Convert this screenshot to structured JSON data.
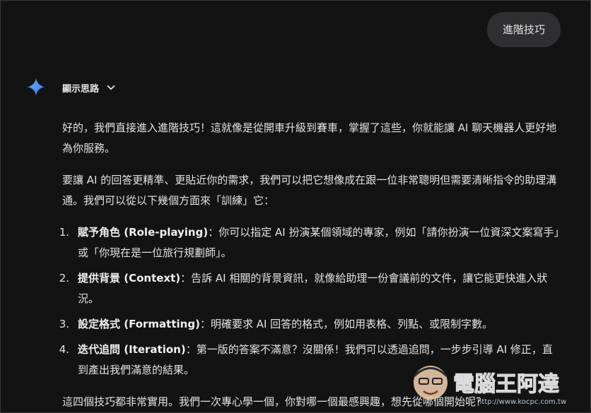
{
  "user_message": "進階技巧",
  "thinking": {
    "label": "顯示思路"
  },
  "response": {
    "intro": "好的，我們直接進入進階技巧！這就像是從開車升級到賽車，掌握了這些，你就能讓 AI 聊天機器人更好地為你服務。",
    "lead": "要讓 AI 的回答更精準、更貼近你的需求，我們可以把它想像成在跟一位非常聰明但需要清晰指令的助理溝通。我們可以從以下幾個方面來「訓練」它：",
    "items": [
      {
        "num": "1.",
        "title": "賦予角色 (Role-playing)",
        "body": "：你可以指定 AI 扮演某個領域的專家，例如「請你扮演一位資深文案寫手」或「你現在是一位旅行規劃師」。"
      },
      {
        "num": "2.",
        "title": "提供背景 (Context)",
        "body": "：告訴 AI 相關的背景資訊，就像給助理一份會議前的文件，讓它能更快進入狀況。"
      },
      {
        "num": "3.",
        "title": "設定格式 (Formatting)",
        "body": "：明確要求 AI 回答的格式，例如用表格、列點、或限制字數。"
      },
      {
        "num": "4.",
        "title": "迭代追問 (Iteration)",
        "body": "：第一版的答案不滿意？沒關係！我們可以透過追問，一步步引導 AI 修正，直到產出我們滿意的結果。"
      }
    ],
    "closing": "這四個技巧都非常實用。我們一次專心學一個，你對哪一個最感興趣，想先從哪個開始呢？"
  },
  "watermark": {
    "brand": "電腦王阿達",
    "url": "http://www.kocpc.com.tw"
  },
  "colors": {
    "background": "#131314",
    "bubble": "#2f2f31",
    "text": "#e3e3e3",
    "gemini_blue": "#4a90f5"
  }
}
